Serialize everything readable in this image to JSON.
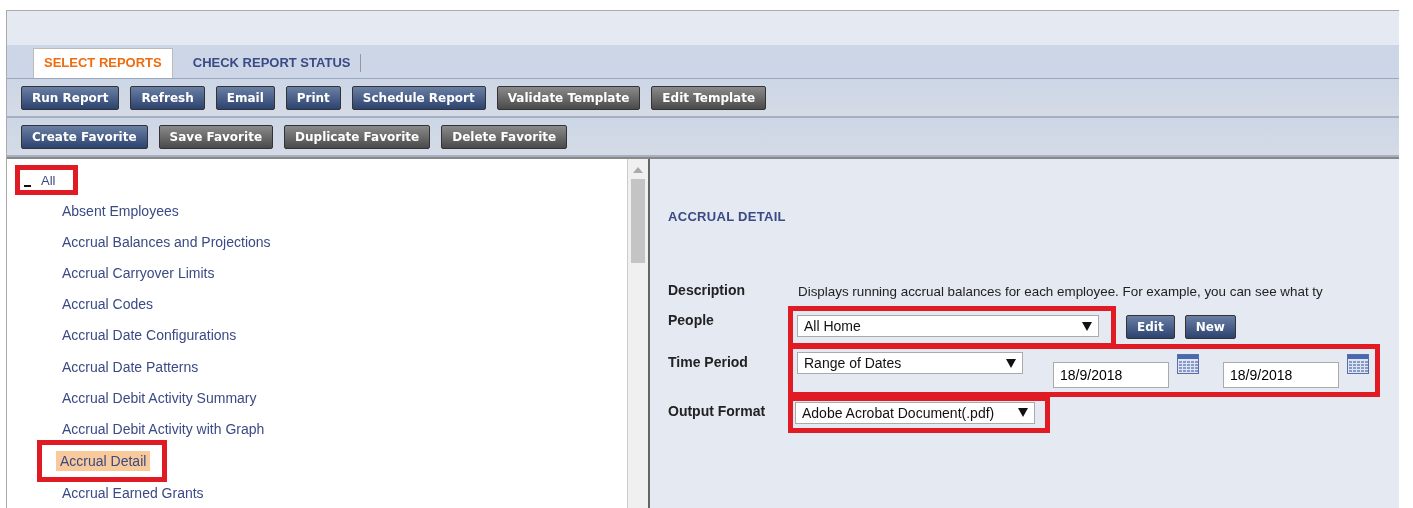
{
  "tabs": [
    {
      "label": "SELECT REPORTS",
      "selected": true
    },
    {
      "label": "CHECK REPORT STATUS",
      "selected": false
    }
  ],
  "toolbar": [
    {
      "label": "Run Report",
      "kind": "primary"
    },
    {
      "label": "Refresh",
      "kind": "primary"
    },
    {
      "label": "Email",
      "kind": "primary"
    },
    {
      "label": "Print",
      "kind": "primary"
    },
    {
      "label": "Schedule Report",
      "kind": "primary"
    },
    {
      "label": "Validate Template",
      "kind": "secondary"
    },
    {
      "label": "Edit Template",
      "kind": "secondary"
    }
  ],
  "favorites_toolbar": [
    {
      "label": "Create Favorite",
      "kind": "primary"
    },
    {
      "label": "Save Favorite",
      "kind": "secondary"
    },
    {
      "label": "Duplicate Favorite",
      "kind": "secondary"
    },
    {
      "label": "Delete Favorite",
      "kind": "secondary"
    }
  ],
  "tree": {
    "label": "All",
    "expanded": true,
    "highlighted": true,
    "children": [
      {
        "label": "Absent Employees",
        "selected": false,
        "highlighted": false
      },
      {
        "label": "Accrual Balances and Projections",
        "selected": false,
        "highlighted": false
      },
      {
        "label": "Accrual Carryover Limits",
        "selected": false,
        "highlighted": false
      },
      {
        "label": "Accrual Codes",
        "selected": false,
        "highlighted": false
      },
      {
        "label": "Accrual Date Configurations",
        "selected": false,
        "highlighted": false
      },
      {
        "label": "Accrual Date Patterns",
        "selected": false,
        "highlighted": false
      },
      {
        "label": "Accrual Debit Activity Summary",
        "selected": false,
        "highlighted": false
      },
      {
        "label": "Accrual Debit Activity with Graph",
        "selected": false,
        "highlighted": false
      },
      {
        "label": "Accrual Detail",
        "selected": true,
        "highlighted": true
      },
      {
        "label": "Accrual Earned Grants",
        "selected": false,
        "highlighted": false
      }
    ]
  },
  "detail": {
    "title": "ACCRUAL DETAIL",
    "description": {
      "label": "Description",
      "text": "Displays running accrual balances for each employee. For example, you can see what ty"
    },
    "people": {
      "label": "People",
      "value": "All Home",
      "highlighted": true,
      "buttons": [
        "Edit",
        "New"
      ]
    },
    "time_period": {
      "label": "Time Period",
      "value": "Range of Dates",
      "start_date": "18/9/2018",
      "end_date": "18/9/2018",
      "highlighted": true
    },
    "output_format": {
      "label": "Output Format",
      "value": "Adobe Acrobat Document(.pdf)",
      "highlighted": true
    }
  }
}
